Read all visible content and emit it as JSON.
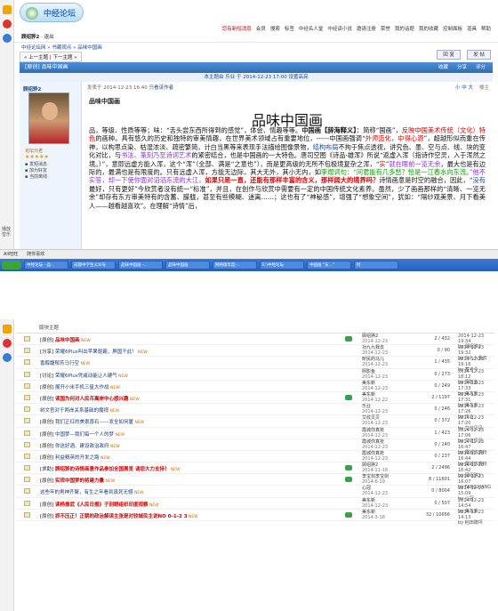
{
  "top": {
    "logo_text": "中经论坛",
    "nav": [
      {
        "label": "您有新短消息",
        "hot": true
      },
      {
        "label": "会员"
      },
      {
        "label": "搜索"
      },
      {
        "label": "标签"
      },
      {
        "label": "中经名人堂"
      },
      {
        "label": "中经读小说"
      },
      {
        "label": "邀请注册"
      },
      {
        "label": "荣誉"
      },
      {
        "label": "我的话题"
      },
      {
        "label": "我的收藏"
      },
      {
        "label": "控制面板"
      },
      {
        "label": "道具"
      },
      {
        "label": "帮助"
      }
    ],
    "user": "顾绍骅2",
    "logout": "退出",
    "breadcrumb": "中经论坛网 » 书藏观点 » 品味中国画",
    "thread_nav": "« 上一主题 | 下一主题 »",
    "reply_btn": "回 复",
    "new_btn": "发 帖"
  },
  "thread": {
    "header_label": "[原创] 品味中国画",
    "actions": [
      "收藏",
      "分享",
      "评分"
    ],
    "sub_info": "本主题由 乐业 于 2014-12-23 17:00 设置高亮",
    "author": "顾绍骅2",
    "rank": "论坛元老",
    "stars": "★★★★★",
    "author_meta": [
      "发短消息",
      "加为好友",
      "当前离线"
    ],
    "post_meta": "发表于 2014-12-23 16:40",
    "only_author": "只看该作者",
    "font_ctl": "小 中 大",
    "floor": "楼主",
    "small_title": "品味中国画",
    "big_title": "品味中国画"
  },
  "body_parts": [
    {
      "t": "品，等级、性质等等；味：“舌头尝东西所得到的感觉”，体会、情趣等等。",
      "c": ""
    },
    {
      "t": "中国画【辞海释义】",
      "c": "b"
    },
    {
      "t": "：简称“国画”，",
      "c": ""
    },
    {
      "t": "反映中国美术传统（文化）特色",
      "c": "red"
    },
    {
      "t": "的画种。具有悠久的历史和独特的审美情趣，在世界美术领域占有重要地位，------中国画强调“",
      "c": ""
    },
    {
      "t": "外师造化，中得心源",
      "c": "red"
    },
    {
      "t": "”，超越形似而重在传神，以构思点染、枯湿浓淡、疏密繁简，计白当黑等来表现手法描绘图像景物，",
      "c": ""
    },
    {
      "t": "结构布局",
      "c": "blu"
    },
    {
      "t": "不拘于焦点透视，讲究色、墨、空与点、线、块的变化对比，与",
      "c": ""
    },
    {
      "t": "书法、篆刻乃至诗词艺术",
      "c": "pur"
    },
    {
      "t": "的紧密结合，也是中国画的一大特色。唐司空图《诗品·雄浑》所说“返虚入浑（指诗作空灵，入于浑然之境。）”，意即远虚方能入浑，这个“浑”（全部、满是“之意也”），而是更高级的无所不包极境复杂之浑，“",
      "c": ""
    },
    {
      "t": "实",
      "c": "red"
    },
    {
      "t": "”",
      "c": ""
    },
    {
      "t": "就在眼前一览无余",
      "c": "pur"
    },
    {
      "t": "，最大也是有边际的，最满也是有限度的。只有远虚入浑，方能无边际，其大无外，其小无内，如",
      "c": ""
    },
    {
      "t": "李煜词句：“问君能有几多愁？恰是一江春水向东流。",
      "c": "grn"
    },
    {
      "t": "”他不实答，却一下使你面对滔滔东流的大江，",
      "c": "pur"
    },
    {
      "t": "如果只是一直，还能有那样丰富的含义，那样阔大的境界吗？",
      "c": "redb"
    },
    {
      "t": "诗情画意是时空的融合，因此，“",
      "c": ""
    },
    {
      "t": "没有",
      "c": "blu"
    },
    {
      "t": "最好，只有更好”今欣赏者没有统一“标准”，并且，在创作与欣赏中需要有一定的中国传统文化素养。虽然，少了画画那样的“清晰、一览无余”却存有东方审美特有的含蓄、朦胧，甚至有些模糊、迷离……；这也有了“神秘感”，增强了“想象空间”，犹如：“隔纱观美景、月下看美人——越看越喜欢”。在理解“诗情”后，",
      "c": ""
    }
  ],
  "statusbar": [
    "Ali旺旺",
    "随你喜欢"
  ],
  "taskbar": [
    "中经论坛 - 品...",
    "成都中学生公众号",
    "品味中国画 -...",
    "品味中国画",
    "网络版年度-...",
    "E:\\中经论坛",
    "中国画 \"东...\"",
    "时"
  ],
  "list": {
    "header": "版块主题",
    "rows": [
      {
        "title": "品味中国画",
        "prefix": "[原创]",
        "hot": true,
        "author": "顾绍骅2",
        "date": "2014-12-23",
        "replies": "2 / 432",
        "last": "2014-12-23 19:34",
        "last_by": "by 顾绍骅2",
        "mark": true
      },
      {
        "title": "荣耀6Plus叫出苹果驱霸，屏国干此！",
        "prefix": "[分享]",
        "hot": false,
        "author": "功九九我去",
        "date": "2014-12-23",
        "replies": "0 / 90",
        "last": "2014-12-23 19:32",
        "last_by": "by 功九九我去",
        "mark": false
      },
      {
        "title": "香醇馥郁芳马行空",
        "prefix": "",
        "hot": false,
        "author": "昕民的马儿",
        "date": "2014-12-23",
        "replies": "1 / 435",
        "last": "2014-12-23 19:16",
        "last_by": "by 蓄考今",
        "mark": false
      },
      {
        "title": "荣耀6Plus凭咸动能让人硬气",
        "prefix": "[讨论]",
        "hot": false,
        "author": "阴影鱼",
        "date": "2014-12-23",
        "replies": "0 / 273",
        "last": "2014-12-23 18:12",
        "last_by": "by 阴影鱼",
        "mark": false
      },
      {
        "title": "展开小米手机三星大作战",
        "prefix": "[原创]",
        "hot": false,
        "author": "美东新",
        "date": "2014-12-23",
        "replies": "0 / 249",
        "last": "2014-12-23 17:33",
        "last_by": "by 美东新",
        "mark": false
      },
      {
        "title": "读国为何对人民币离岸中心感兴趣",
        "prefix": "[原创]",
        "hot": true,
        "author": "美东新",
        "date": "2014-12-22",
        "replies": "2 / 1197",
        "last": "2014-12-23 17:31",
        "last_by": "by 美东新",
        "mark": true
      },
      {
        "title": "树文官对于两岸关系基础的魔视",
        "prefix": "",
        "hot": false,
        "author": "乐业",
        "date": "2014-12-23",
        "replies": "0 / 246",
        "last": "2014-12-23 17:26",
        "last_by": "by 乐业",
        "mark": false
      },
      {
        "title": "我们正红的美景喜石——发全如何厦",
        "prefix": "[原创]",
        "hot": false,
        "author": "艾纹贝贝",
        "date": "2014-12-23",
        "replies": "0 / 372",
        "last": "2014-12-23 17:20",
        "last_by": "by 艾纹贝贝",
        "mark": false
      },
      {
        "title": "中国梦—我们每一个人的梦",
        "prefix": "[原创]",
        "hot": false,
        "author": "霞城你真抢",
        "date": "2014-12-23",
        "replies": "1 / 423",
        "last": "2014-12-23 17:06",
        "last_by": "by 艾纹贝贝",
        "mark": false
      },
      {
        "title": "你这好酒、建设政治政府",
        "prefix": "[原创]",
        "hot": false,
        "author": "霞城你真抢",
        "date": "2014-12-23",
        "replies": "0 / 240",
        "last": "2014-12-23 16:47",
        "last_by": "by 霞城你真抢",
        "mark": false
      },
      {
        "title": "利益精英的开发之路",
        "prefix": "[原创]",
        "hot": false,
        "author": "霞城你真抢",
        "date": "2014-12-23",
        "replies": "0 / 237",
        "last": "2014-12-23 16:44",
        "last_by": "by 霞城你真抢",
        "mark": false
      },
      {
        "title": "顾绍骅的诗情画意作品参加全国展览 请您大力支持！",
        "prefix": "[求助]",
        "hot": true,
        "author": "顾绍骅2",
        "date": "2014-11-18",
        "replies": "2 / 2496",
        "last": "2014-12-23 16:42",
        "last_by": "by 顾绍骅2",
        "mark": true
      },
      {
        "title": "实现中国梦的将建力量",
        "prefix": "[原创]",
        "hot": true,
        "author": "李宝剑李宝剑",
        "date": "2014-6-19",
        "replies": "8 / 11601",
        "last": "2014-12-23 16:07",
        "last_by": "by FANGXIANG",
        "mark": true
      },
      {
        "title": "这些年的男神齐聚，有生之年看到真死无憾",
        "prefix": "",
        "hot": false,
        "author": "心冠",
        "date": "2014-12-23",
        "replies": "0 / 8004",
        "last": "2014-12-23 15:09",
        "last_by": "by 心冠",
        "mark": false
      },
      {
        "title": "读杨振武《人民日报》子刻眼组织印度视察",
        "prefix": "[原创]",
        "hot": true,
        "author": "美东新",
        "date": "2014-12-23",
        "replies": "0 / 507",
        "last": "2014-12-23 14:54",
        "last_by": "by 美东新",
        "mark": false
      },
      {
        "title": "抓不压正！正朝的政治解读主张是对较城民主说NO 0-1-2 3",
        "prefix": "[原创]",
        "hot": true,
        "author": "美东新",
        "date": "2014-3-18",
        "replies": "32 / 10656",
        "last": "2014-12-23 14:13",
        "last_by": "by 稻田蹲坪",
        "mark": true
      }
    ]
  }
}
